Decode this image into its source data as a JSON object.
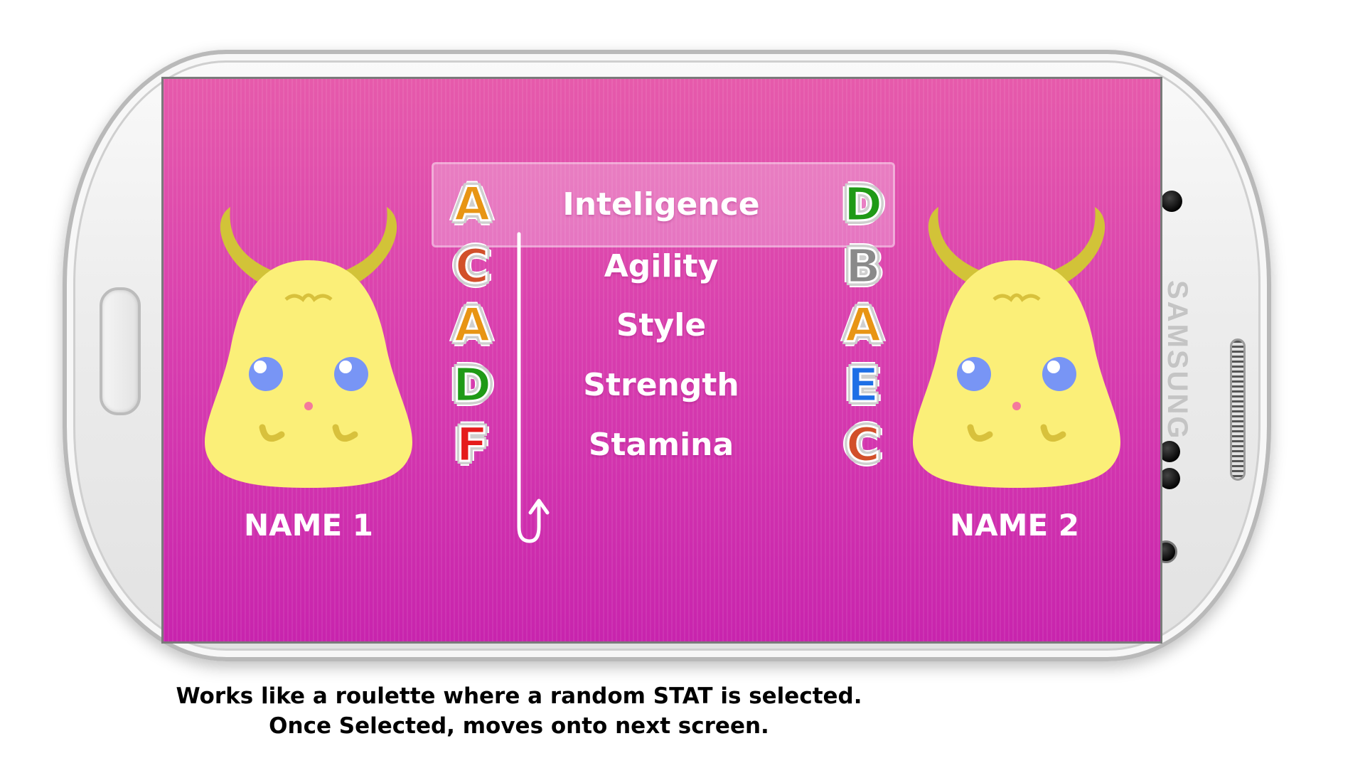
{
  "device": {
    "brand": "SAMSUNG"
  },
  "game": {
    "stats": [
      {
        "label": "Inteligence",
        "left_grade": "A",
        "right_grade": "D",
        "selected": true
      },
      {
        "label": "Agility",
        "left_grade": "C",
        "right_grade": "B",
        "selected": false
      },
      {
        "label": "Style",
        "left_grade": "A",
        "right_grade": "A",
        "selected": false
      },
      {
        "label": "Strength",
        "left_grade": "D",
        "right_grade": "E",
        "selected": false
      },
      {
        "label": "Stamina",
        "left_grade": "F",
        "right_grade": "C",
        "selected": false
      }
    ],
    "players": {
      "left_name": "NAME 1",
      "right_name": "NAME 2"
    },
    "grade_colors": {
      "A": "#e89514",
      "B": "#8a8a8a",
      "C": "#d2502a",
      "D": "#1f9a16",
      "E": "#1e6fe6",
      "F": "#e51c1c"
    },
    "colors": {
      "background_top": "#e65aab",
      "background_bottom": "#c824ad",
      "monster_body": "#fbef78",
      "monster_horn": "#d2c338",
      "monster_eye": "#7895f5"
    }
  },
  "caption": {
    "line1": "Works like a roulette where a random STAT is selected.",
    "line2": "Once Selected, moves onto next screen."
  }
}
